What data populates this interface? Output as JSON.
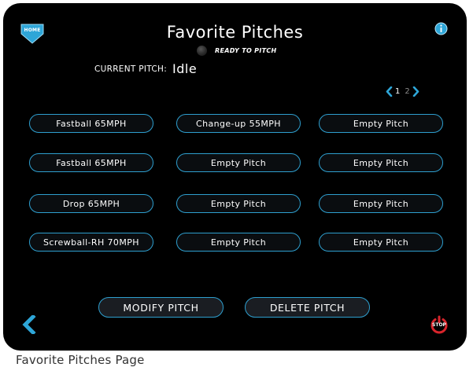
{
  "header": {
    "home_label": "HOME",
    "title": "Favorite Pitches",
    "status_text": "READY TO PITCH",
    "info_icon": "info-icon"
  },
  "current_pitch": {
    "label": "CURRENT PITCH:",
    "value": "Idle"
  },
  "pager": {
    "pages": [
      "1",
      "2"
    ],
    "current_page": "1"
  },
  "pitches": {
    "r1c1": "Fastball 65MPH",
    "r1c2": "Change-up 55MPH",
    "r1c3": "Empty Pitch",
    "r2c1": "Fastball 65MPH",
    "r2c2": "Empty Pitch",
    "r2c3": "Empty Pitch",
    "r3c1": "Drop 65MPH",
    "r3c2": "Empty Pitch",
    "r3c3": "Empty Pitch",
    "r4c1": "Screwball-RH 70MPH",
    "r4c2": "Empty Pitch",
    "r4c3": "Empty Pitch"
  },
  "actions": {
    "modify_label": "MODIFY PITCH",
    "delete_label": "DELETE PITCH"
  },
  "footer": {
    "stop_label": "STOP"
  },
  "caption": "Favorite Pitches Page",
  "colors": {
    "accent": "#2e9fcf",
    "background": "#000000",
    "stop_red": "#d8242b"
  }
}
